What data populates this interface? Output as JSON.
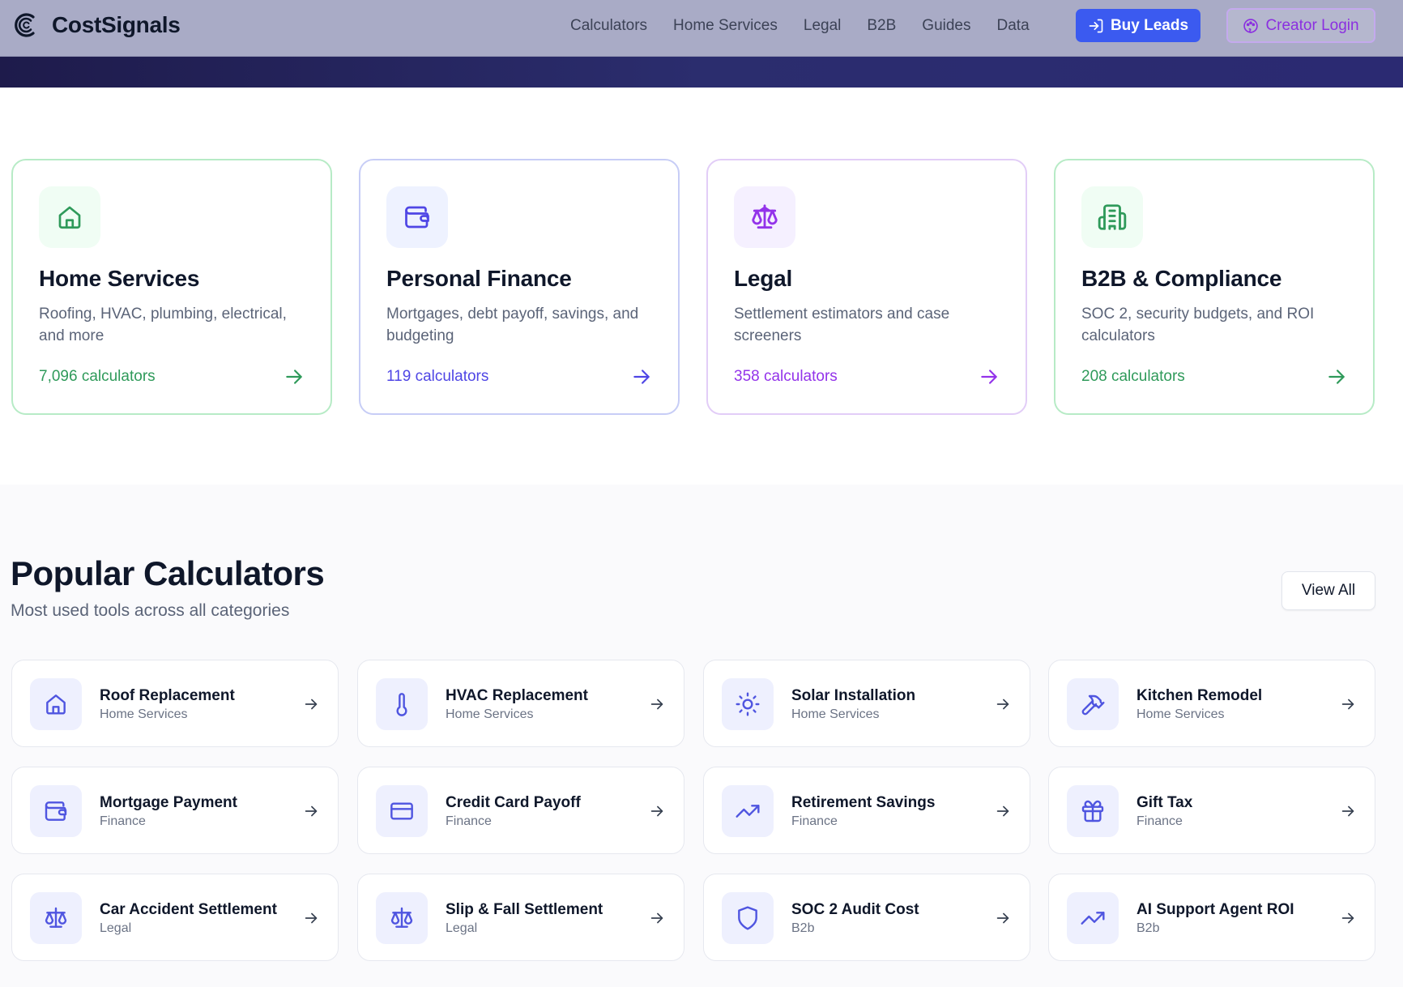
{
  "nav": {
    "brand": "CostSignals",
    "links": [
      "Calculators",
      "Home Services",
      "Legal",
      "B2B",
      "Guides",
      "Data"
    ],
    "buy_leads": "Buy Leads",
    "creator_login": "Creator Login"
  },
  "categories": [
    {
      "title": "Home Services",
      "desc": "Roofing, HVAC, plumbing, electrical, and more",
      "count": "7,096 calculators",
      "icon": "home-icon",
      "color": "#16a34a",
      "bg": "#f0fdf4",
      "border": "#b7ebc6"
    },
    {
      "title": "Personal Finance",
      "desc": "Mortgages, debt payoff, savings, and budgeting",
      "count": "119 calculators",
      "icon": "wallet-icon",
      "color": "#4f46e5",
      "bg": "#eef2ff",
      "border": "#c7cdf6"
    },
    {
      "title": "Legal",
      "desc": "Settlement estimators and case screeners",
      "count": "358 calculators",
      "icon": "scale-icon",
      "color": "#9333ea",
      "bg": "#f5f0ff",
      "border": "#e2cdf7"
    },
    {
      "title": "B2B & Compliance",
      "desc": "SOC 2, security budgets, and ROI calculators",
      "count": "208 calculators",
      "icon": "building-icon",
      "color": "#16a34a",
      "bg": "#f0fdf4",
      "border": "#b7ebc6"
    }
  ],
  "popular": {
    "title": "Popular Calculators",
    "subtitle": "Most used tools across all categories",
    "view_all": "View All",
    "items": [
      {
        "title": "Roof Replacement",
        "category": "Home Services",
        "icon": "home-icon"
      },
      {
        "title": "HVAC Replacement",
        "category": "Home Services",
        "icon": "thermometer-icon"
      },
      {
        "title": "Solar Installation",
        "category": "Home Services",
        "icon": "sun-icon"
      },
      {
        "title": "Kitchen Remodel",
        "category": "Home Services",
        "icon": "hammer-icon"
      },
      {
        "title": "Mortgage Payment",
        "category": "Finance",
        "icon": "wallet-icon"
      },
      {
        "title": "Credit Card Payoff",
        "category": "Finance",
        "icon": "credit-card-icon"
      },
      {
        "title": "Retirement Savings",
        "category": "Finance",
        "icon": "trending-up-icon"
      },
      {
        "title": "Gift Tax",
        "category": "Finance",
        "icon": "gift-icon"
      },
      {
        "title": "Car Accident Settlement",
        "category": "Legal",
        "icon": "scale-icon"
      },
      {
        "title": "Slip & Fall Settlement",
        "category": "Legal",
        "icon": "scale-icon"
      },
      {
        "title": "SOC 2 Audit Cost",
        "category": "B2b",
        "icon": "shield-icon"
      },
      {
        "title": "AI Support Agent ROI",
        "category": "B2b",
        "icon": "trending-up-icon"
      }
    ]
  },
  "colors": {
    "brand_blue": "#3b5af0",
    "creator_purple": "#8b2fe0",
    "icon_indigo": "#4f55e0",
    "nav_bg": "#a9abc6"
  }
}
